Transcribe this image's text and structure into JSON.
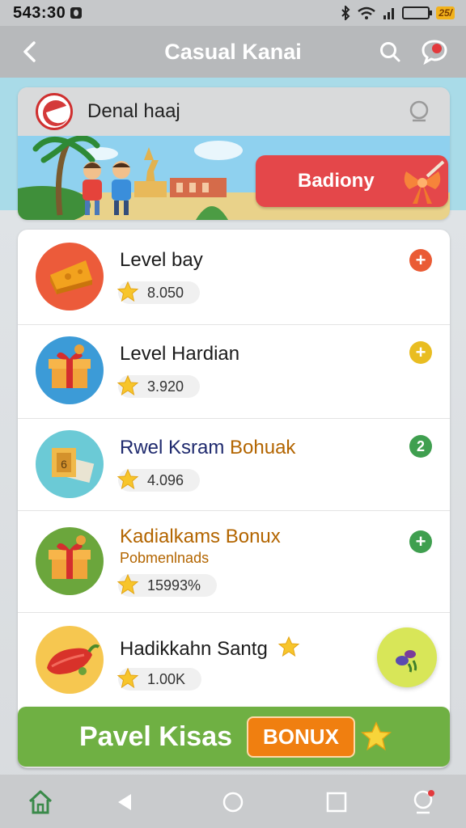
{
  "status_bar": {
    "time": "543:30",
    "battery_badge": "25/"
  },
  "app_bar": {
    "title": "Casual Kanai"
  },
  "header": {
    "brand_name": "Denal haaj",
    "banner_button": "Badiony"
  },
  "list": {
    "items": [
      {
        "title": "Level bay",
        "score": "8.050",
        "icon": "cheese-icon",
        "action_color": "#ea5b35"
      },
      {
        "title": "Level Hardian",
        "score": "3.920",
        "icon": "gift-box-icon",
        "action_color": "#e9bd21"
      },
      {
        "title_part1": "Rwel Ksram ",
        "title_part2": "Bohuak",
        "score": "4.096",
        "icon": "money-icon",
        "action_label": "2",
        "action_color": "#3f9f4f"
      },
      {
        "title": "Kadialkams Bonux",
        "subtitle": "Pobmenlnads",
        "score": "15993%",
        "icon": "gift-box-icon",
        "action_color": "#3f9f4f"
      },
      {
        "title": "Hadikkahn Santg",
        "score": "1.00K",
        "icon": "chili-pepper-icon"
      }
    ]
  },
  "bottom_banner": {
    "text": "Pavel Kisas",
    "badge": "BONUX"
  },
  "colors": {
    "accent_red": "#e4474a",
    "accent_green": "#6fb043",
    "accent_orange": "#f07f10"
  }
}
